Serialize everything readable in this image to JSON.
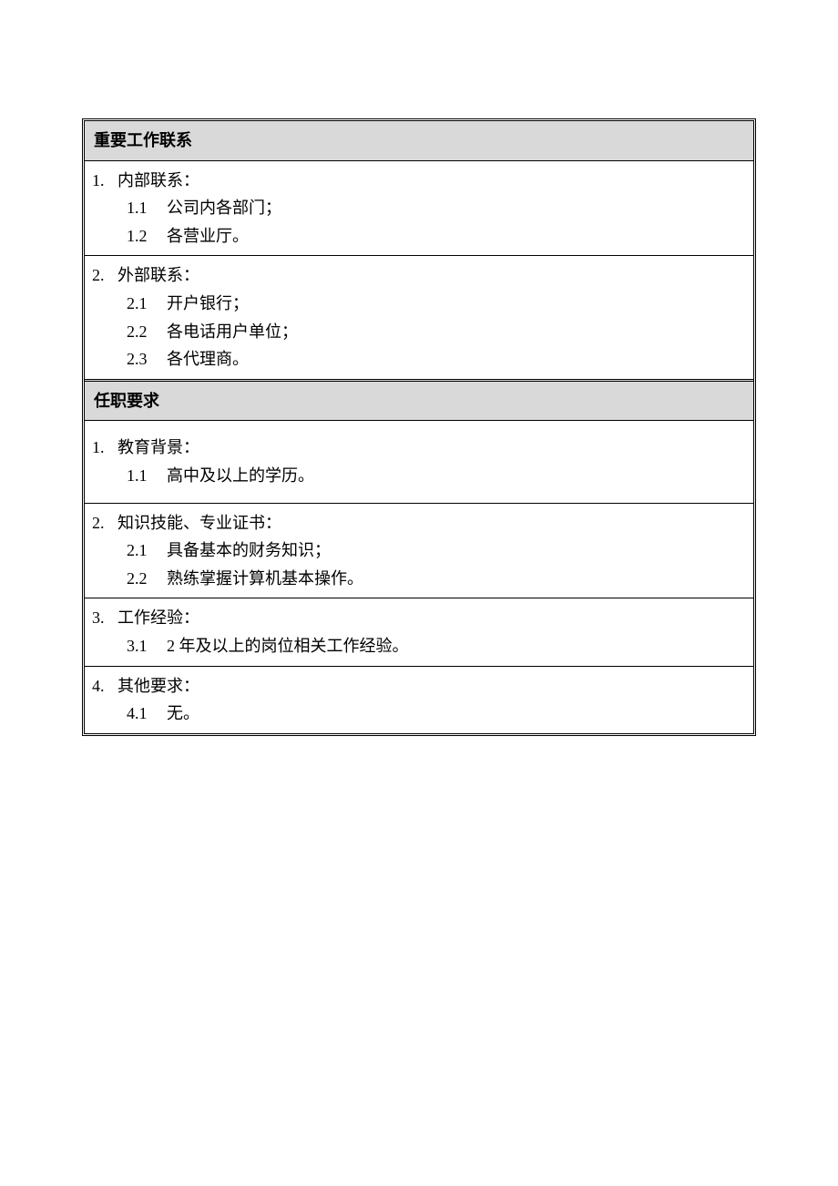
{
  "sections": {
    "contacts": {
      "title": "重要工作联系",
      "items": [
        {
          "num": "1.",
          "label": "内部联系：",
          "children": [
            {
              "num": "1.1",
              "text": "公司内各部门；"
            },
            {
              "num": "1.2",
              "text": "各营业厅。"
            }
          ]
        },
        {
          "num": "2.",
          "label": "外部联系：",
          "children": [
            {
              "num": "2.1",
              "text": "开户银行；"
            },
            {
              "num": "2.2",
              "text": "各电话用户单位；"
            },
            {
              "num": "2.3",
              "text": "各代理商。"
            }
          ]
        }
      ]
    },
    "requirements": {
      "title": "任职要求",
      "items": [
        {
          "num": "1.",
          "label": "教育背景：",
          "children": [
            {
              "num": "1.1",
              "text": "高中及以上的学历。"
            }
          ]
        },
        {
          "num": "2.",
          "label": "知识技能、专业证书：",
          "children": [
            {
              "num": "2.1",
              "text": "具备基本的财务知识；"
            },
            {
              "num": "2.2",
              "text": "熟练掌握计算机基本操作。"
            }
          ]
        },
        {
          "num": "3.",
          "label": "工作经验：",
          "children": [
            {
              "num": "3.1",
              "text": "2 年及以上的岗位相关工作经验。"
            }
          ]
        },
        {
          "num": "4.",
          "label": "其他要求：",
          "children": [
            {
              "num": "4.1",
              "text": "无。"
            }
          ]
        }
      ]
    }
  }
}
